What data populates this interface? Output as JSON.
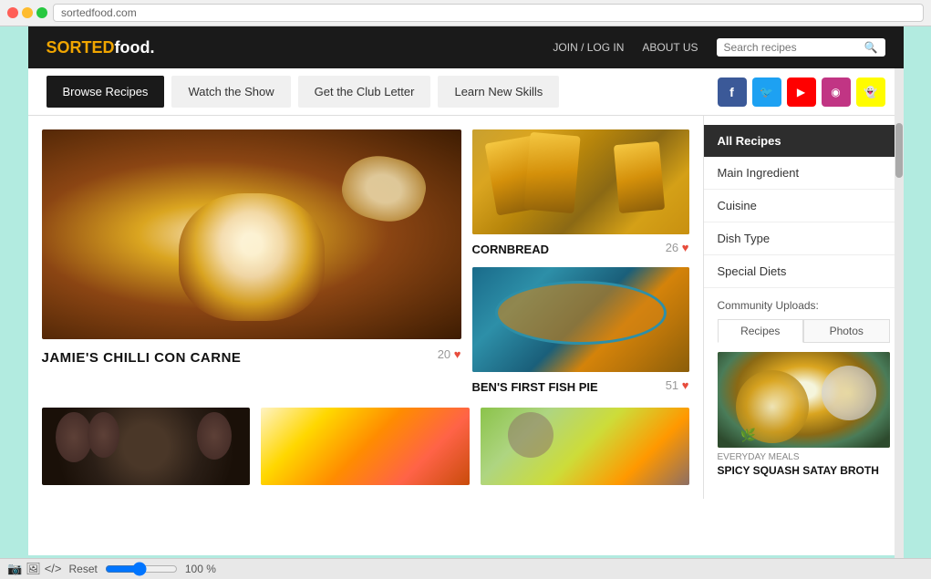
{
  "browser": {
    "address": "sortedfood.com",
    "bottom_controls": {
      "reset_label": "Reset",
      "zoom_value": "100 %"
    }
  },
  "header": {
    "logo_main": "SORTED",
    "logo_sub": "food.",
    "nav": {
      "join_login": "JOIN / LOG IN",
      "about_us": "ABOUT US"
    },
    "search": {
      "placeholder": "Search recipes"
    }
  },
  "nav_buttons": [
    {
      "label": "Browse Recipes",
      "active": true
    },
    {
      "label": "Watch the Show",
      "active": false
    },
    {
      "label": "Get the Club Letter",
      "active": false
    },
    {
      "label": "Learn New Skills",
      "active": false
    }
  ],
  "social_icons": [
    {
      "name": "facebook",
      "symbol": "f"
    },
    {
      "name": "twitter",
      "symbol": "t"
    },
    {
      "name": "youtube",
      "symbol": "▶"
    },
    {
      "name": "instagram",
      "symbol": "◉"
    },
    {
      "name": "snapchat",
      "symbol": "👻"
    }
  ],
  "recipes": {
    "featured_large": {
      "title": "JAMIE'S CHILLI CON CARNE",
      "likes": "20"
    },
    "featured_small": [
      {
        "title": "CORNBREAD",
        "likes": "26"
      },
      {
        "title": "BEN'S FIRST FISH PIE",
        "likes": "51"
      }
    ]
  },
  "sidebar": {
    "items": [
      {
        "label": "All Recipes",
        "active": true
      },
      {
        "label": "Main Ingredient",
        "active": false
      },
      {
        "label": "Cuisine",
        "active": false
      },
      {
        "label": "Dish Type",
        "active": false
      },
      {
        "label": "Special Diets",
        "active": false
      }
    ],
    "community": {
      "title": "Community Uploads:",
      "tabs": [
        "Recipes",
        "Photos"
      ],
      "featured_category": "Everyday Meals",
      "featured_title": "SPICY SQUASH SATAY BROTH"
    }
  }
}
